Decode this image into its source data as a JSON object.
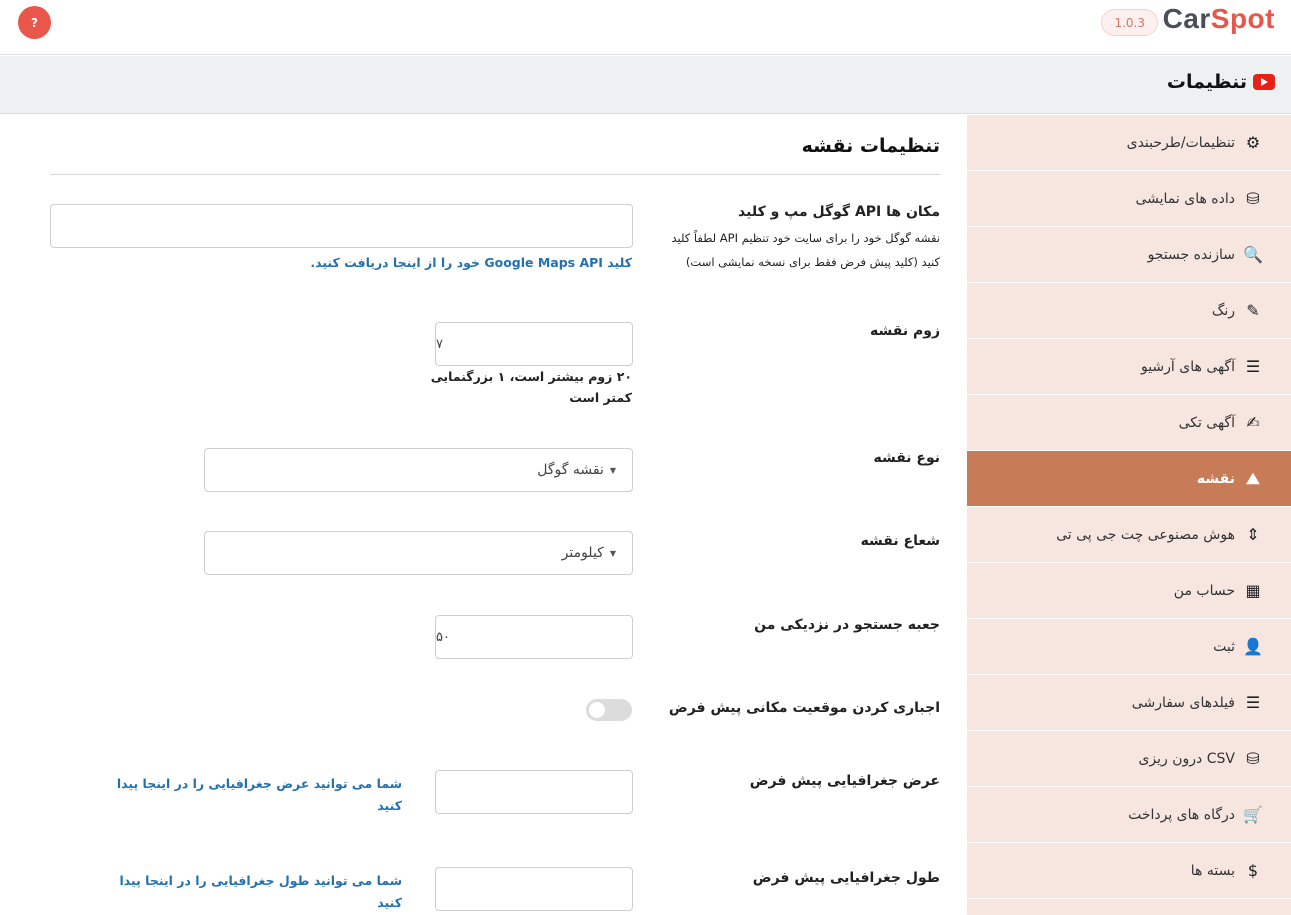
{
  "header": {
    "help_label": "?",
    "version": "1.0.3",
    "logo_car": "Car",
    "logo_spot": "Spot"
  },
  "titlebar": {
    "title": "تنظیمات"
  },
  "sidebar": {
    "items": [
      {
        "label": "تنظیمات/طرحبندی",
        "icon": "gear-icon",
        "glyph": "⚙"
      },
      {
        "label": "داده های نمایشی",
        "icon": "database-icon",
        "glyph": "⛁"
      },
      {
        "label": "سازنده جستجو",
        "icon": "search-icon",
        "glyph": "🔍"
      },
      {
        "label": "رنگ",
        "icon": "eyedropper-icon",
        "glyph": "✎"
      },
      {
        "label": "آگهی های آرشیو",
        "icon": "list-icon",
        "glyph": "☰"
      },
      {
        "label": "آگهی تکی",
        "icon": "edit-icon",
        "glyph": "✍"
      },
      {
        "label": "نقشه",
        "icon": "map-icon",
        "glyph": "⛰"
      },
      {
        "label": "هوش مصنوعی چت جی پی تی",
        "icon": "sort-icon",
        "glyph": "⇕"
      },
      {
        "label": "حساب من",
        "icon": "table-icon",
        "glyph": "▦"
      },
      {
        "label": "ثبت",
        "icon": "user-icon",
        "glyph": "👤"
      },
      {
        "label": "فیلدهای سفارشی",
        "icon": "list-icon",
        "glyph": "☰"
      },
      {
        "label": "درون ریزی CSV",
        "icon": "database-icon",
        "glyph": "⛁"
      },
      {
        "label": "درگاه های پرداخت",
        "icon": "cart-icon",
        "glyph": "🛒"
      },
      {
        "label": "بسته ها",
        "icon": "dollar-icon",
        "glyph": "$"
      }
    ],
    "active_index": 6
  },
  "main": {
    "section_title": "تنظیمات نقشه",
    "api_key": {
      "label": "گوگل مپ و کلید API مکان ها",
      "desc_line1": "لطفاً کلید API نقشه گوگل خود را برای سایت خود تنظیم",
      "desc_line2": "کنید (کلید پیش فرض فقط برای نسخه نمایشی است)",
      "value": "",
      "link": "کلید Google Maps API خود را از اینجا دریافت کنید."
    },
    "zoom": {
      "label": "زوم نقشه",
      "value": "۷",
      "help_line1": "۲۰ زوم بیشتر است، ۱ بزرگنمایی",
      "help_line2": "کمتر است"
    },
    "map_type": {
      "label": "نوع نقشه",
      "value": "نقشه گوگل"
    },
    "radius": {
      "label": "شعاع نقشه",
      "value": "کیلومتر"
    },
    "near_me": {
      "label": "جعبه جستجو در نزدیکی من",
      "value": "۵۰"
    },
    "force_location": {
      "label": "اجباری کردن موقعیت مکانی پیش فرض",
      "enabled": false
    },
    "latitude": {
      "label": "عرض جغرافیایی پیش فرض",
      "value": "",
      "link_line1": "شما می توانید عرض جغرافیایی را در اینجا پیدا",
      "link_line2": "کنید"
    },
    "longitude": {
      "label": "طول جغرافیایی پیش فرض",
      "value": "",
      "link_line1": "شما می توانید طول جغرافیایی را در اینجا پیدا",
      "link_line2": "کنید"
    }
  }
}
